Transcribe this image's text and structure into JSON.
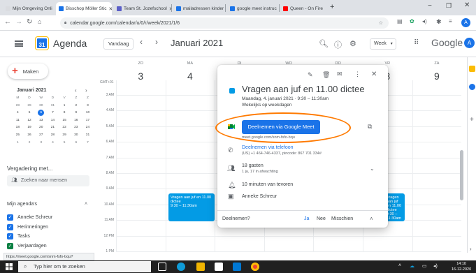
{
  "browser": {
    "tabs": [
      {
        "label": "Mijn Omgeving Onli",
        "active": false,
        "favicon": "#dadce0"
      },
      {
        "label": "Bisschop Möller Stic",
        "active": true,
        "favicon": "#1a73e8"
      },
      {
        "label": "Team St. Jozefschool",
        "active": false,
        "favicon": "#5b5fc7"
      },
      {
        "label": "mailadressen kinder",
        "active": false,
        "favicon": "#1a73e8"
      },
      {
        "label": "google meet instruc",
        "active": false,
        "favicon": "#1a73e8"
      },
      {
        "label": "Queen - On Fire",
        "active": false,
        "favicon": "#ff0000"
      }
    ],
    "new_tab": "+",
    "url": "calendar.google.com/calendar/u/0/r/week/2021/1/6"
  },
  "header": {
    "app_title": "Agenda",
    "logo_text": "31",
    "today_button": "Vandaag",
    "prev": "‹",
    "next": "›",
    "month_label": "Januari 2021",
    "view_select": "Week",
    "google_text": "Google",
    "avatar_letter": "A"
  },
  "sidebar": {
    "create_label": "Maken",
    "mini_month": "Januari 2021",
    "weekday_headers": [
      "M",
      "D",
      "W",
      "D",
      "V",
      "Z",
      "Z"
    ],
    "weeks": [
      [
        "28",
        "29",
        "30",
        "31",
        "1",
        "2",
        "3"
      ],
      [
        "4",
        "5",
        "6",
        "7",
        "8",
        "9",
        "10"
      ],
      [
        "11",
        "12",
        "13",
        "14",
        "15",
        "16",
        "17"
      ],
      [
        "18",
        "19",
        "20",
        "21",
        "22",
        "23",
        "24"
      ],
      [
        "25",
        "26",
        "27",
        "28",
        "29",
        "30",
        "31"
      ],
      [
        "1",
        "2",
        "3",
        "4",
        "5",
        "6",
        "7"
      ]
    ],
    "meet_label": "Vergadering met...",
    "search_people": "Zoeken naar mensen",
    "my_calendars": "Mijn agenda's",
    "calendars": [
      {
        "label": "Anneke Schreur",
        "color": "#1a73e8"
      },
      {
        "label": "Herinneringen",
        "color": "#1a73e8"
      },
      {
        "label": "Tasks",
        "color": "#1a73e8"
      },
      {
        "label": "Verjaardagen",
        "color": "#0b8043"
      }
    ]
  },
  "grid": {
    "gmt": "GMT+01",
    "days": [
      {
        "name": "ZO",
        "num": "3"
      },
      {
        "name": "MA",
        "num": "4"
      },
      {
        "name": "DI",
        "num": "5"
      },
      {
        "name": "WO",
        "num": "6"
      },
      {
        "name": "DO",
        "num": "7"
      },
      {
        "name": "VR",
        "num": "8"
      },
      {
        "name": "ZA",
        "num": "9"
      }
    ],
    "hours": [
      "3 AM",
      "4 AM",
      "5 AM",
      "6 AM",
      "7 AM",
      "8 AM",
      "9 AM",
      "10 AM",
      "11 AM",
      "12 PM",
      "1 PM"
    ],
    "event_main": {
      "title": "Vragen aan juf en 11.00 dictee",
      "time": "9:30 – 11:30am"
    },
    "event_right": {
      "title": "Vragen aan juf en 11.00 dictee",
      "time": "9:30 – 11:30am"
    }
  },
  "popup": {
    "title": "Vragen aan juf en 11.00 dictee",
    "date": "Maandag, 4. januari 2021  ·  9:30 – 11:30am",
    "repeat": "Wekelijks op weekdagen",
    "meet_button": "Deelnemen via Google Meet",
    "meet_link": "meet.google.com/snm-fsfo-bqu",
    "phone_title": "Deelnemen via telefoon",
    "phone_detail": "(US) +1 464-746-4337, pincode: 867 701 334#",
    "guests": "18 gasten",
    "guests_detail": "1 ja, 17 in afwachting",
    "reminder": "10 minuten van tevoren",
    "organizer": "Anneke Schreur",
    "rsvp_question": "Deelnemen?",
    "rsvp_yes": "Ja",
    "rsvp_no": "Nee",
    "rsvp_maybe": "Misschien"
  },
  "status_url": "https://meet.google.com/snm-fsfo-bqu?authuser=0&hs=122",
  "taskbar": {
    "search_placeholder": "Typ hier om te zoeken",
    "time": "14:10",
    "date": "16-12-2020"
  },
  "colors": {
    "accent": "#1a73e8",
    "event": "#039be5",
    "highlight": "#ff7a00"
  }
}
